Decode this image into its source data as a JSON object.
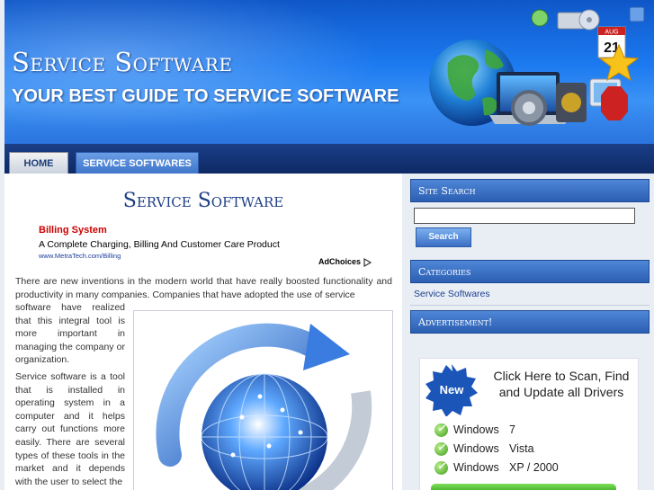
{
  "header": {
    "site_title": "Service Software",
    "tagline": "YOUR BEST GUIDE TO SERVICE SOFTWARE",
    "calendar_label": "AUG",
    "calendar_day": "21"
  },
  "nav": {
    "tabs": [
      {
        "label": "HOME"
      },
      {
        "label": "SERVICE SOFTWARES"
      }
    ]
  },
  "main": {
    "title": "Service Software",
    "ad": {
      "title": "Billing System",
      "description": "A Complete Charging, Billing And Customer Care Product",
      "url": "www.MetraTech.com/Billing",
      "adchoices": "AdChoices"
    },
    "paragraph1_a": "There are new inventions in the modern world that have really boosted functionality and productivity in many companies. Companies that have adopted the use of service",
    "paragraph1_b": "software have realized that this integral tool is more important in managing the company or organization.",
    "paragraph2": "Service software is a tool that is installed in operating system in a computer and it helps carry out functions more easily. There are several types of these tools in the market and it depends with the user to select the"
  },
  "sidebar": {
    "search_heading": "Site Search",
    "search_button": "Search",
    "search_value": "",
    "categories_heading": "Categories",
    "categories": [
      {
        "label": "Service Softwares"
      }
    ],
    "ad_heading": "Advertisement!",
    "ad": {
      "badge": "New",
      "headline": "Click Here to Scan, Find and Update all Drivers",
      "rows": [
        {
          "name": "Windows",
          "version": "7"
        },
        {
          "name": "Windows",
          "version": "Vista"
        },
        {
          "name": "Windows",
          "version": "XP / 2000"
        }
      ]
    }
  },
  "colors": {
    "header_blue": "#1c7af0",
    "nav_dark": "#0e2a66",
    "title_blue": "#1f3f86",
    "ad_red": "#cc0000",
    "sidebar_head": "#2b5fb3"
  }
}
